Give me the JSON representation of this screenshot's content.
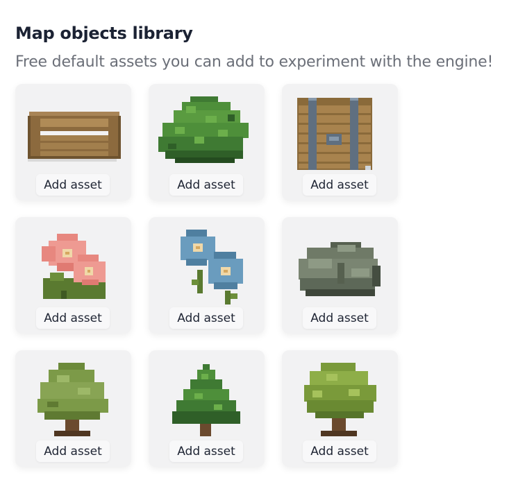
{
  "header": {
    "title": "Map objects library",
    "subtitle": "Free default assets you can add to experiment with the engine!"
  },
  "assets": [
    {
      "icon": "bench-icon",
      "button_label": "Add asset"
    },
    {
      "icon": "bush-icon",
      "button_label": "Add asset"
    },
    {
      "icon": "chest-icon",
      "button_label": "Add asset"
    },
    {
      "icon": "pink-flowers-icon",
      "button_label": "Add asset"
    },
    {
      "icon": "blue-flowers-icon",
      "button_label": "Add asset"
    },
    {
      "icon": "rock-icon",
      "button_label": "Add asset"
    },
    {
      "icon": "tree-icon",
      "button_label": "Add asset"
    },
    {
      "icon": "pine-tree-icon",
      "button_label": "Add asset"
    },
    {
      "icon": "leafy-tree-icon",
      "button_label": "Add asset"
    }
  ],
  "colors": {
    "card_background": "#f2f2f3",
    "title": "#1b2233",
    "subtitle": "#6b6f78"
  }
}
